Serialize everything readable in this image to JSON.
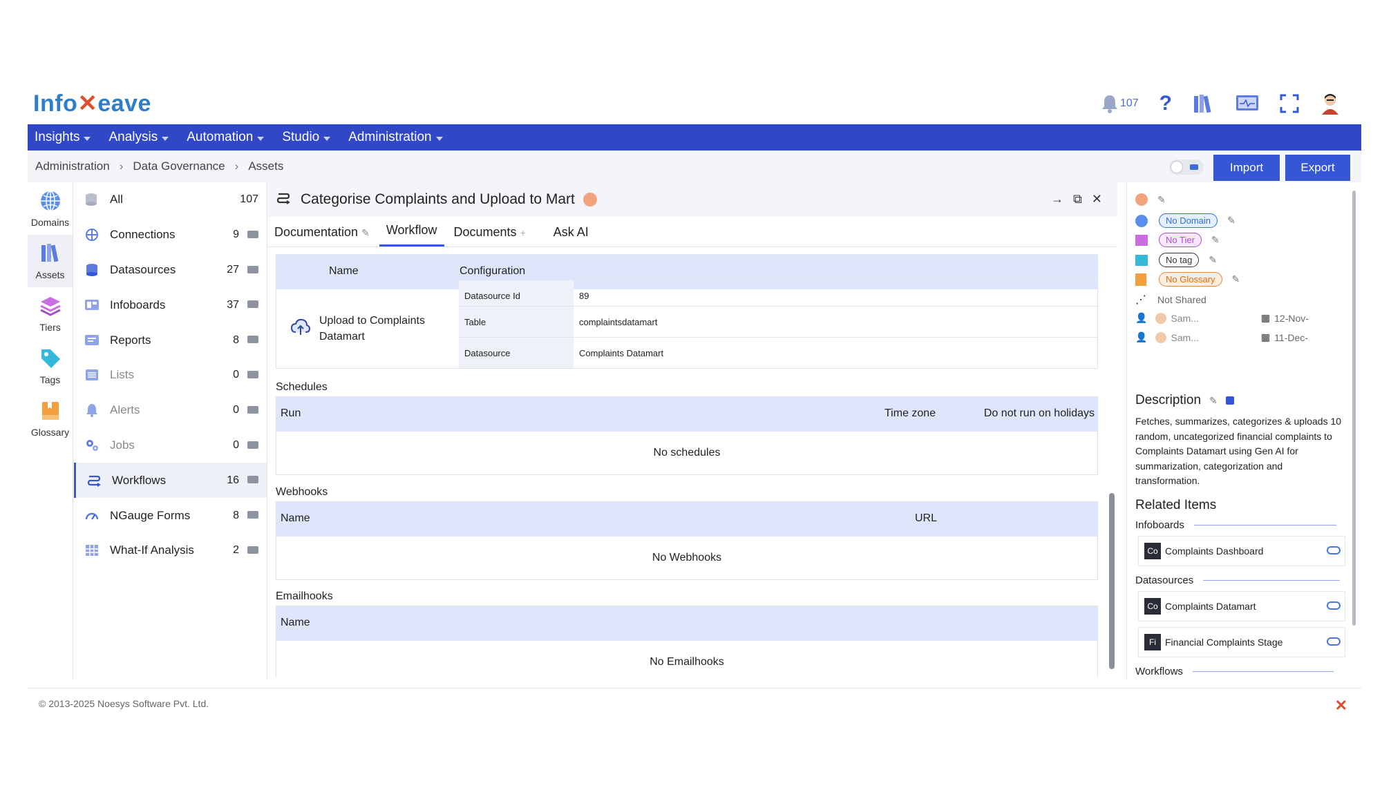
{
  "header": {
    "logo_pre": "Info",
    "logo_post": "eave",
    "notifications_count": "107"
  },
  "nav": [
    "Insights",
    "Analysis",
    "Automation",
    "Studio",
    "Administration"
  ],
  "breadcrumb": [
    "Administration",
    "Data Governance",
    "Assets"
  ],
  "actions": {
    "import": "Import",
    "export": "Export"
  },
  "rail": [
    "Domains",
    "Assets",
    "Tiers",
    "Tags",
    "Glossary"
  ],
  "assets": [
    {
      "label": "All",
      "count": "107"
    },
    {
      "label": "Connections",
      "count": "9"
    },
    {
      "label": "Datasources",
      "count": "27"
    },
    {
      "label": "Infoboards",
      "count": "37"
    },
    {
      "label": "Reports",
      "count": "8"
    },
    {
      "label": "Lists",
      "count": "0"
    },
    {
      "label": "Alerts",
      "count": "0"
    },
    {
      "label": "Jobs",
      "count": "0"
    },
    {
      "label": "Workflows",
      "count": "16"
    },
    {
      "label": "NGauge Forms",
      "count": "8"
    },
    {
      "label": "What-If Analysis",
      "count": "2"
    }
  ],
  "panel": {
    "title": "Categorise Complaints and Upload to Mart",
    "tabs": [
      "Documentation",
      "Workflow",
      "Documents",
      "Ask AI"
    ],
    "config": {
      "col_name": "Name",
      "col_config": "Configuration",
      "step_name": "Upload to Complaints Datamart",
      "rows": [
        {
          "k": "Datasource Id",
          "v": "89"
        },
        {
          "k": "Table",
          "v": "complaintsdatamart"
        },
        {
          "k": "Datasource",
          "v": "Complaints Datamart"
        }
      ]
    },
    "schedules": {
      "label": "Schedules",
      "cols": [
        "Run",
        "Time zone",
        "Do not run on holidays"
      ],
      "empty": "No schedules"
    },
    "webhooks": {
      "label": "Webhooks",
      "cols": [
        "Name",
        "URL"
      ],
      "empty": "No Webhooks"
    },
    "emailhooks": {
      "label": "Emailhooks",
      "cols": [
        "Name"
      ],
      "empty": "No Emailhooks"
    }
  },
  "side": {
    "domain": "No Domain",
    "tier": "No Tier",
    "tag": "No tag",
    "glossary": "No Glossary",
    "shared": "Not Shared",
    "created_by": "Sam...",
    "created_on": "12-Nov-",
    "updated_by": "Sam...",
    "updated_on": "11-Dec-",
    "description_title": "Description",
    "description": "Fetches, summarizes, categorizes & uploads 10 random, uncategorized financial complaints to Complaints Datamart using Gen AI for summarization, categorization and transformation.",
    "related_title": "Related Items",
    "infoboards_label": "Infoboards",
    "infoboards": [
      {
        "badge": "Co",
        "name": "Complaints Dashboard"
      }
    ],
    "datasources_label": "Datasources",
    "datasources": [
      {
        "badge": "Co",
        "name": "Complaints Datamart"
      },
      {
        "badge": "Fi",
        "name": "Financial Complaints Stage"
      }
    ],
    "workflows_label": "Workflows"
  },
  "footer": "© 2013-2025 Noesys Software Pvt. Ltd."
}
